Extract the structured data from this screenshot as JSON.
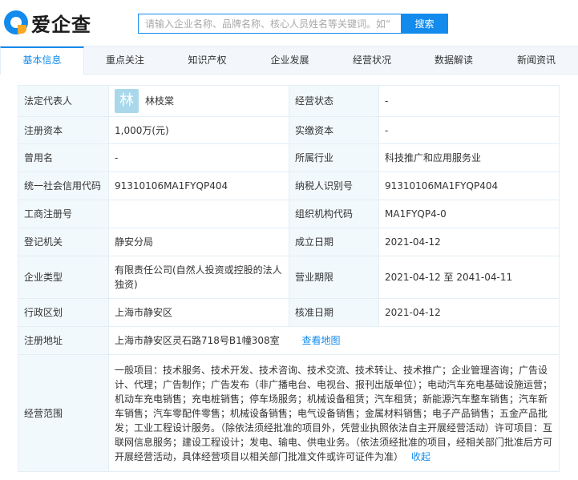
{
  "header": {
    "logo_text": "爱企查",
    "search_placeholder": "请输入企业名称、品牌名称、核心人员姓名等关键词。如“",
    "search_button": "搜索"
  },
  "tabs": [
    "基本信息",
    "重点关注",
    "知识产权",
    "企业发展",
    "经营状况",
    "数据解读",
    "新闻资讯"
  ],
  "active_tab": "基本信息",
  "info": {
    "legal_rep_label": "法定代表人",
    "legal_rep_avatar": "林",
    "legal_rep_name": "林枝棠",
    "status_label": "经营状态",
    "status_value": "-",
    "reg_capital_label": "注册资本",
    "reg_capital_value": "1,000万(元)",
    "paid_capital_label": "实缴资本",
    "paid_capital_value": "-",
    "former_name_label": "曾用名",
    "former_name_value": "-",
    "industry_label": "所属行业",
    "industry_value": "科技推广和应用服务业",
    "credit_code_label": "统一社会信用代码",
    "credit_code_value": "91310106MA1FYQP404",
    "taxpayer_label": "纳税人识别号",
    "taxpayer_value": "91310106MA1FYQP404",
    "biz_reg_no_label": "工商注册号",
    "biz_reg_no_value": "",
    "org_code_label": "组织机构代码",
    "org_code_value": "MA1FYQP4-0",
    "authority_label": "登记机关",
    "authority_value": "静安分局",
    "established_label": "成立日期",
    "established_value": "2021-04-12",
    "company_type_label": "企业类型",
    "company_type_value": "有限责任公司(自然人投资或控股的法人独资)",
    "term_label": "营业期限",
    "term_value": "2021-04-12 至 2041-04-11",
    "district_label": "行政区划",
    "district_value": "上海市静安区",
    "approval_label": "核准日期",
    "approval_value": "2021-04-12",
    "address_label": "注册地址",
    "address_value": "上海市静安区灵石路718号B1幢308室",
    "map_link": "查看地图",
    "scope_label": "经营范围",
    "scope_value": "一般项目：技术服务、技术开发、技术咨询、技术交流、技术转让、技术推广；企业管理咨询；广告设计、代理；广告制作；广告发布（非广播电台、电视台、报刊出版单位）；电动汽车充电基础设施运营；机动车充电销售；充电桩销售；停车场服务；机械设备租赁；汽车租赁；新能源汽车整车销售；汽车新车销售；汽车零配件零售；机械设备销售；电气设备销售；金属材料销售；电子产品销售；五金产品批发；工业工程设计服务。（除依法须经批准的项目外，凭营业执照依法自主开展经营活动）许可项目：互联网信息服务；建设工程设计；发电、输电、供电业务。（依法须经批准的项目，经相关部门批准后方可开展经营活动，具体经营项目以相关部门批准文件或许可证件为准）",
    "collapse_link": "收起"
  }
}
